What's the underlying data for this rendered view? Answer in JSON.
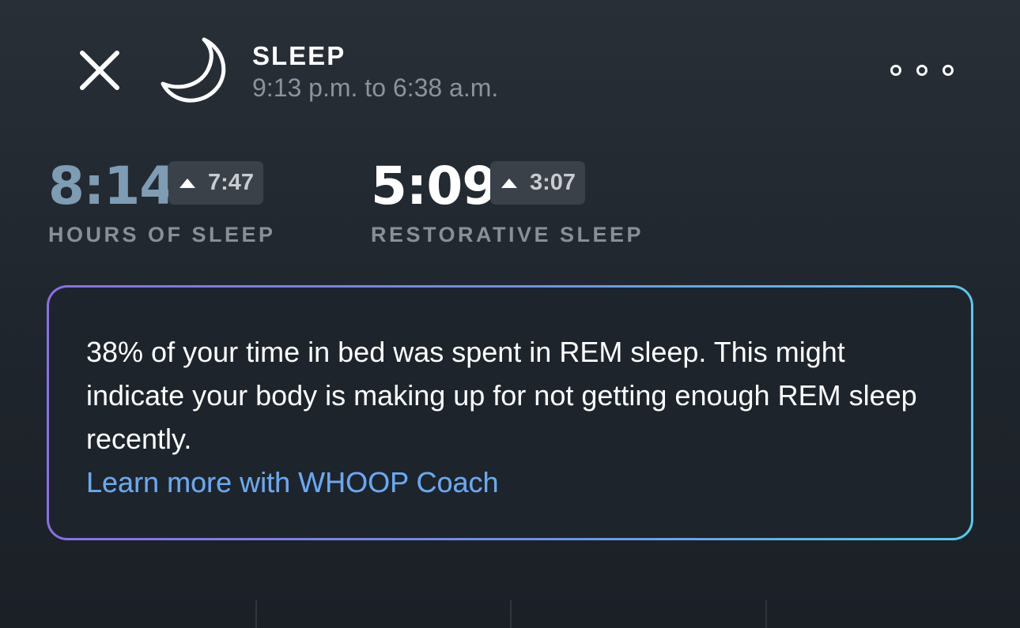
{
  "header": {
    "title": "SLEEP",
    "time_range": "9:13 p.m. to 6:38 a.m."
  },
  "stats": {
    "hours_of_sleep": {
      "value": "8:14",
      "delta": "7:47",
      "label": "HOURS OF SLEEP",
      "color": "#7f9cb5"
    },
    "restorative_sleep": {
      "value": "5:09",
      "delta": "3:07",
      "label": "RESTORATIVE SLEEP",
      "color": "#ffffff"
    }
  },
  "insight": {
    "text": "38% of your time in bed was spent in REM sleep. This might indicate your body is making up for not getting enough REM sleep recently.",
    "link": "Learn more with WHOOP Coach",
    "border_gradient": [
      "#8b6ee6",
      "#58c8ea"
    ]
  },
  "icons": {
    "close": "close-icon",
    "moon": "moon-icon",
    "more": "more-options-icon",
    "delta_arrow": "triangle-up-icon"
  }
}
